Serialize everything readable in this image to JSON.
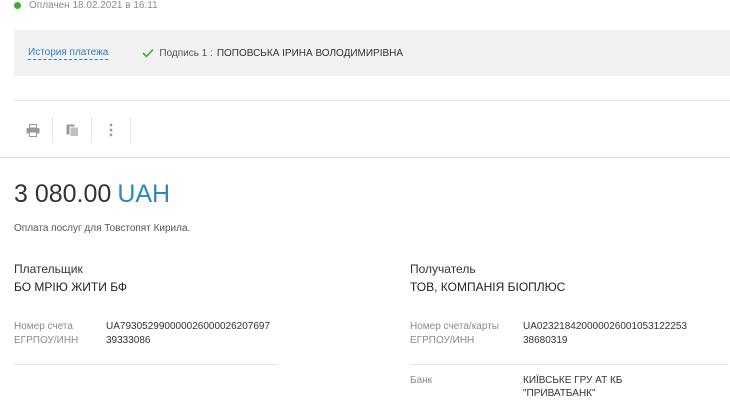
{
  "status": {
    "text": "Оплачен 18.02.2021 в 16:11",
    "color": "#3fae2a"
  },
  "signature": {
    "history_link": "История платежа",
    "sign_label": "Подпись 1 :",
    "sign_name": "ПОПОВСЬКА ІРИНА ВОЛОДИМИРІВНА"
  },
  "toolbar": {
    "icons": [
      "print-icon",
      "copy-icon",
      "more-icon"
    ]
  },
  "payment": {
    "amount": "3 080.00",
    "currency": "UAH",
    "purpose": "Оплата послуг для Товстопят Кирила."
  },
  "payer": {
    "title": "Плательщик",
    "name": "БО МРІЮ ЖИТИ БФ",
    "account_label": "Номер счета",
    "account_value": "UA793052990000026000026207697",
    "code_label": "ЕГРПОУ/ИНН",
    "code_value": "39333086"
  },
  "receiver": {
    "title": "Получатель",
    "name": "ТОВ, КОМПАНІЯ БІОПЛЮС",
    "account_label": "Номер счета/карты",
    "account_value": "UA023218420000026001053122253",
    "code_label": "ЕГРПОУ/ИНН",
    "code_value": "38680319",
    "bank_label": "Банк",
    "bank_line1": "КИЇВСЬКЕ ГРУ АТ КБ",
    "bank_line2": "\"ПРИВАТБАНК\""
  }
}
